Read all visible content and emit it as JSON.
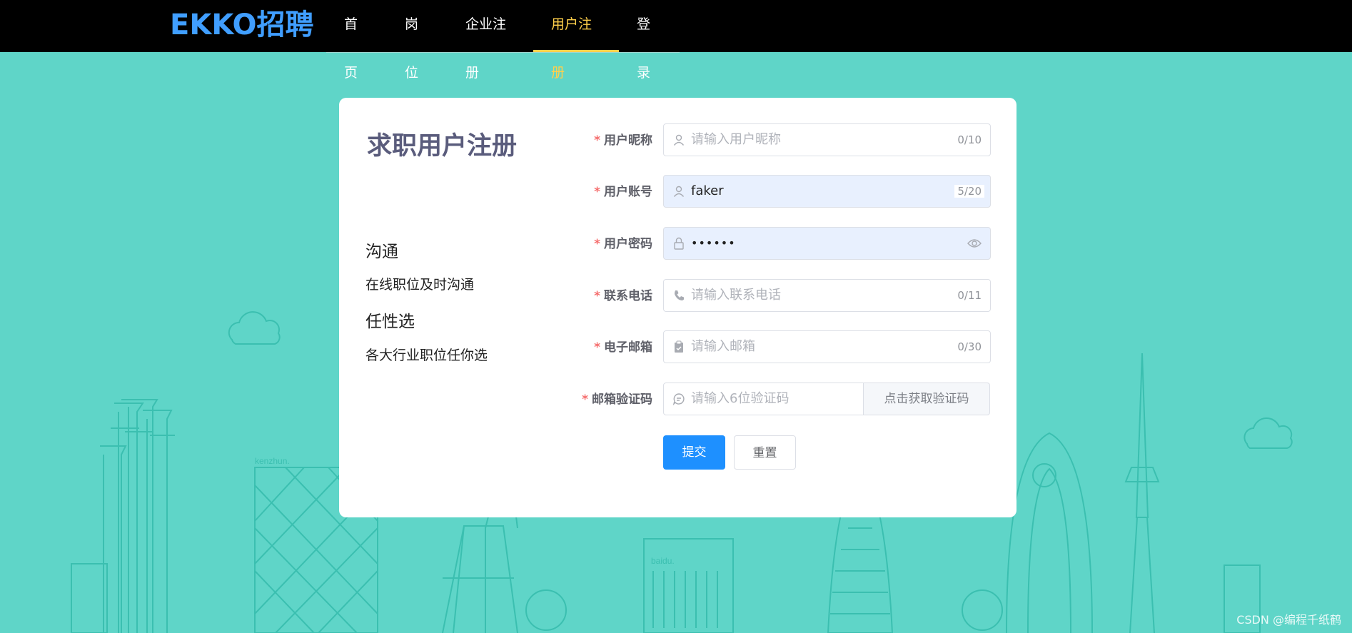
{
  "app": {
    "logo": "EKKO招聘"
  },
  "nav": {
    "items": [
      {
        "label": "首页"
      },
      {
        "label": "岗位"
      },
      {
        "label": "企业注册"
      },
      {
        "label": "用户注册"
      },
      {
        "label": "登录"
      }
    ],
    "active_index": 3
  },
  "card": {
    "title": "求职用户注册",
    "features": [
      {
        "heading": "沟通",
        "desc": "在线职位及时沟通"
      },
      {
        "heading": "任性选",
        "desc": "各大行业职位任你选"
      }
    ]
  },
  "form": {
    "required_mark": "*",
    "nickname": {
      "label": "用户昵称",
      "placeholder": "请输入用户昵称",
      "value": "",
      "counter": "0/10",
      "icon": "user-icon"
    },
    "account": {
      "label": "用户账号",
      "placeholder": "",
      "value": "faker",
      "counter": "5/20",
      "icon": "user-icon"
    },
    "password": {
      "label": "用户密码",
      "value": "••••••",
      "icon": "lock-icon",
      "toggle_icon": "eye-icon"
    },
    "phone": {
      "label": "联系电话",
      "placeholder": "请输入联系电话",
      "value": "",
      "counter": "0/11",
      "icon": "phone-icon"
    },
    "email": {
      "label": "电子邮箱",
      "placeholder": "请输入邮箱",
      "value": "",
      "counter": "0/30",
      "icon": "clipboard-icon"
    },
    "code": {
      "label": "邮箱验证码",
      "placeholder": "请输入6位验证码",
      "value": "",
      "button": "点击获取验证码",
      "icon": "chat-icon"
    },
    "submit": "提交",
    "reset": "重置"
  },
  "background": {
    "building_labels": [
      "kenzhun.",
      "baidu."
    ]
  },
  "watermark": "CSDN @编程千纸鹤",
  "colors": {
    "background": "#5fd5c8",
    "header": "#000000",
    "brand": "#409eff",
    "nav_active": "#ffd04b",
    "primary": "#1e90ff",
    "required": "#f56c6c",
    "autofill": "#e8f0fe"
  }
}
